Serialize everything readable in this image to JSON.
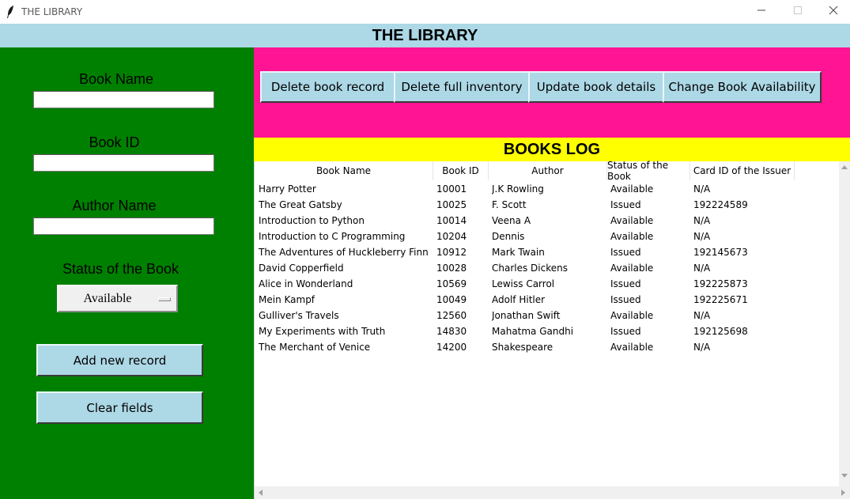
{
  "window": {
    "title": "THE LIBRARY"
  },
  "header": {
    "title": "THE LIBRARY"
  },
  "form": {
    "book_name_label": "Book Name",
    "book_name_value": "",
    "book_id_label": "Book ID",
    "book_id_value": "",
    "author_label": "Author Name",
    "author_value": "",
    "status_label": "Status of the Book",
    "status_value": "Available",
    "add_label": "Add new record",
    "clear_label": "Clear fields"
  },
  "actions": {
    "delete_record": "Delete book record",
    "delete_inventory": "Delete full inventory",
    "update_details": "Update book details",
    "change_availability": "Change Book Availability"
  },
  "log": {
    "title": "BOOKS LOG",
    "columns": [
      "Book Name",
      "Book ID",
      "Author",
      "Status of the Book",
      "Card ID of the Issuer"
    ],
    "rows": [
      [
        "Harry Potter",
        "10001",
        "J.K Rowling",
        "Available",
        "N/A"
      ],
      [
        "The Great Gatsby",
        "10025",
        "F. Scott",
        "Issued",
        "192224589"
      ],
      [
        "Introduction to Python",
        "10014",
        "Veena A",
        "Available",
        "N/A"
      ],
      [
        "Introduction to C Programming",
        "10204",
        "Dennis",
        "Available",
        "N/A"
      ],
      [
        "The Adventures of Huckleberry Finn",
        "10912",
        "Mark Twain",
        "Issued",
        "192145673"
      ],
      [
        "David Copperfield",
        "10028",
        "Charles Dickens",
        "Available",
        "N/A"
      ],
      [
        "Alice in Wonderland",
        "10569",
        "Lewiss Carrol",
        "Issued",
        "192225873"
      ],
      [
        "Mein Kampf",
        "10049",
        "Adolf Hitler",
        "Issued",
        "192225671"
      ],
      [
        "Gulliver's Travels",
        "12560",
        "Jonathan Swift",
        "Available",
        "N/A"
      ],
      [
        "My Experiments with Truth",
        "14830",
        "Mahatma Gandhi",
        "Issued",
        "192125698"
      ],
      [
        "The Merchant of Venice",
        "14200",
        "Shakespeare",
        "Available",
        "N/A"
      ]
    ]
  },
  "colors": {
    "header_bg": "#add8e6",
    "left_panel_bg": "#008000",
    "action_panel_bg": "#ff1493",
    "log_header_bg": "#ffff00",
    "button_bg": "#add8e6"
  },
  "icons": {
    "app": "feather-icon",
    "minimize": "minimize-icon",
    "maximize": "maximize-icon",
    "close": "close-icon"
  }
}
